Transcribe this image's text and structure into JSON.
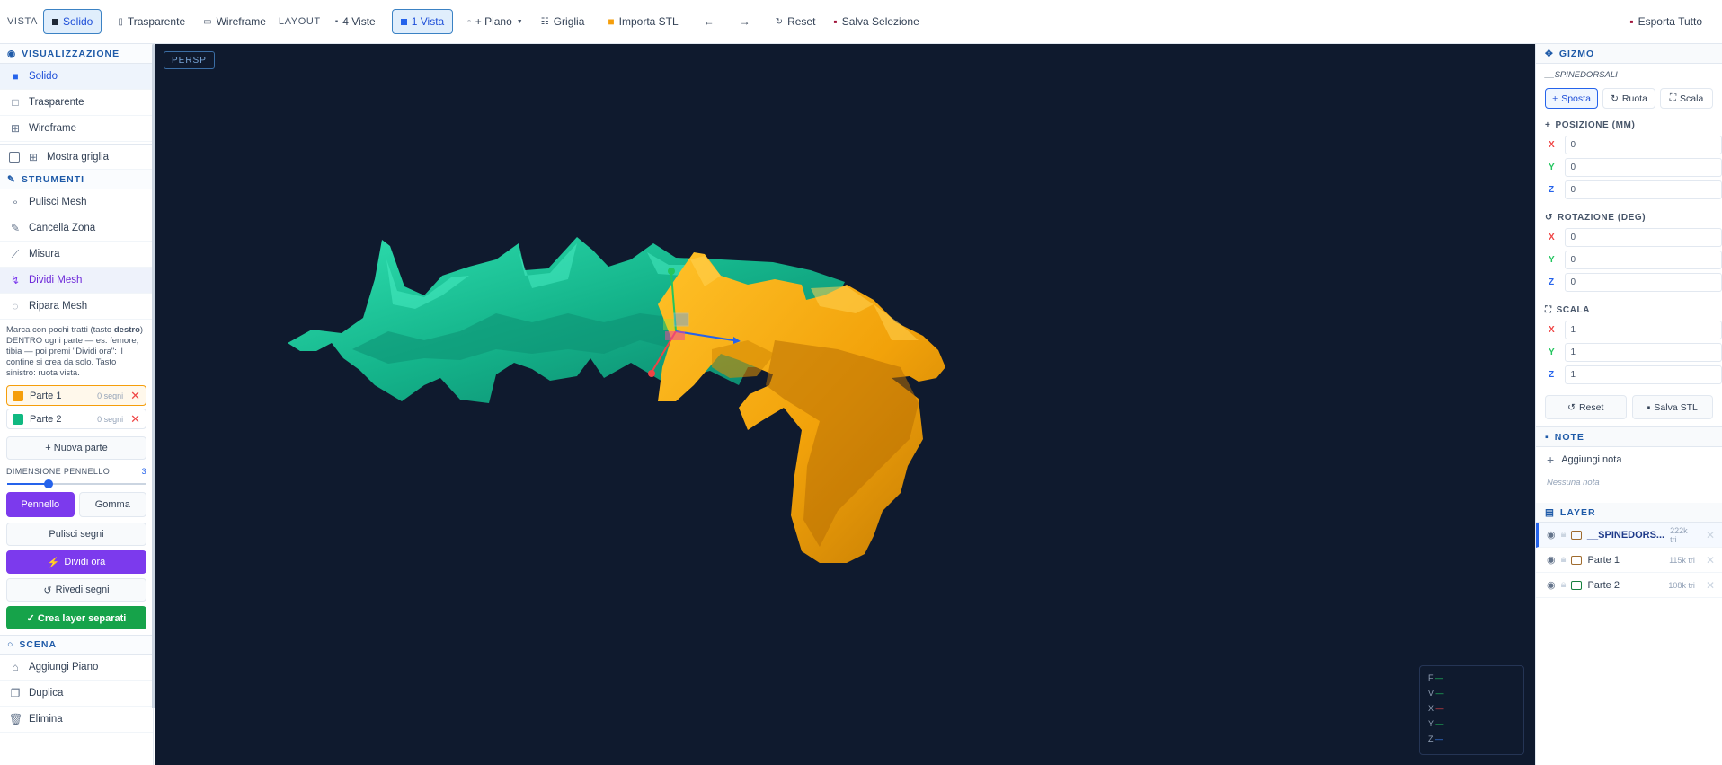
{
  "toolbar": {
    "vista_label": "VISTA",
    "solid": "Solido",
    "transparent": "Trasparente",
    "wireframe": "Wireframe",
    "layout_label": "LAYOUT",
    "four_views": "4 Viste",
    "one_view": "1 Vista",
    "plane": "+ Piano",
    "grid": "Griglia",
    "import": "Importa STL",
    "undo": "←",
    "redo": "→",
    "reset": "Reset",
    "save_selection": "Salva Selezione",
    "export_all": "Esporta Tutto"
  },
  "left": {
    "vis_title": "VISUALIZZAZIONE",
    "vis_items": [
      "Solido",
      "Trasparente",
      "Wireframe"
    ],
    "show_grid": "Mostra griglia",
    "tools_title": "STRUMENTI",
    "tools": [
      "Pulisci Mesh",
      "Cancella Zona",
      "Misura",
      "Dividi Mesh",
      "Ripara Mesh"
    ],
    "help_a": "Marca con pochi tratti (tasto ",
    "help_b": "destro",
    "help_c": ") DENTRO ogni parte — es. femore, tibia — poi premi \"Dividi ora\": il confine si crea da solo. Tasto sinistro: ruota vista.",
    "parts": [
      {
        "name": "Parte 1",
        "count": "0 segni",
        "color": "#f59e0b"
      },
      {
        "name": "Parte 2",
        "count": "0 segni",
        "color": "#10b981"
      }
    ],
    "new_part": "+ Nuova parte",
    "brush_label": "DIMENSIONE PENNELLO",
    "brush_value": "3",
    "brush_level": 0.3,
    "pen": "Pennello",
    "eraser": "Gomma",
    "clear_marks": "Pulisci segni",
    "split_now": "Dividi ora",
    "review": "Rivedi segni",
    "create_layers": "✓ Crea layer separati",
    "scene_title": "SCENA",
    "scene_items": [
      "Aggiungi Piano",
      "Duplica",
      "Elimina"
    ]
  },
  "viewport": {
    "persp": "PERSP",
    "axes": [
      "F",
      "V",
      "X",
      "Y",
      "Z"
    ],
    "bg": "#0f1a2e",
    "mesh_green": "#10b981",
    "mesh_orange": "#f5a70c"
  },
  "right": {
    "gizmo_title": "GIZMO",
    "object_name": "__SPINEDORSALI",
    "move": "Sposta",
    "rotate": "Ruota",
    "scale": "Scala",
    "pos_title": "POSIZIONE (MM)",
    "pos": [
      "0",
      "0",
      "0"
    ],
    "rot_title": "ROTAZIONE (DEG)",
    "rot": [
      "0",
      "0",
      "0"
    ],
    "scale_title": "SCALA",
    "scl": [
      "1",
      "1",
      "1"
    ],
    "axis_x": "X",
    "axis_y": "Y",
    "axis_z": "Z",
    "reset": "Reset",
    "save_stl": "Salva STL",
    "notes_title": "NOTE",
    "add_note": "Aggiungi nota",
    "no_note": "Nessuna nota",
    "layer_title": "LAYER",
    "layers": [
      {
        "name": "__SPINEDORS...",
        "tri": "222k tri"
      },
      {
        "name": "Parte 1",
        "tri": "115k tri"
      },
      {
        "name": "Parte 2",
        "tri": "108k tri"
      }
    ]
  }
}
